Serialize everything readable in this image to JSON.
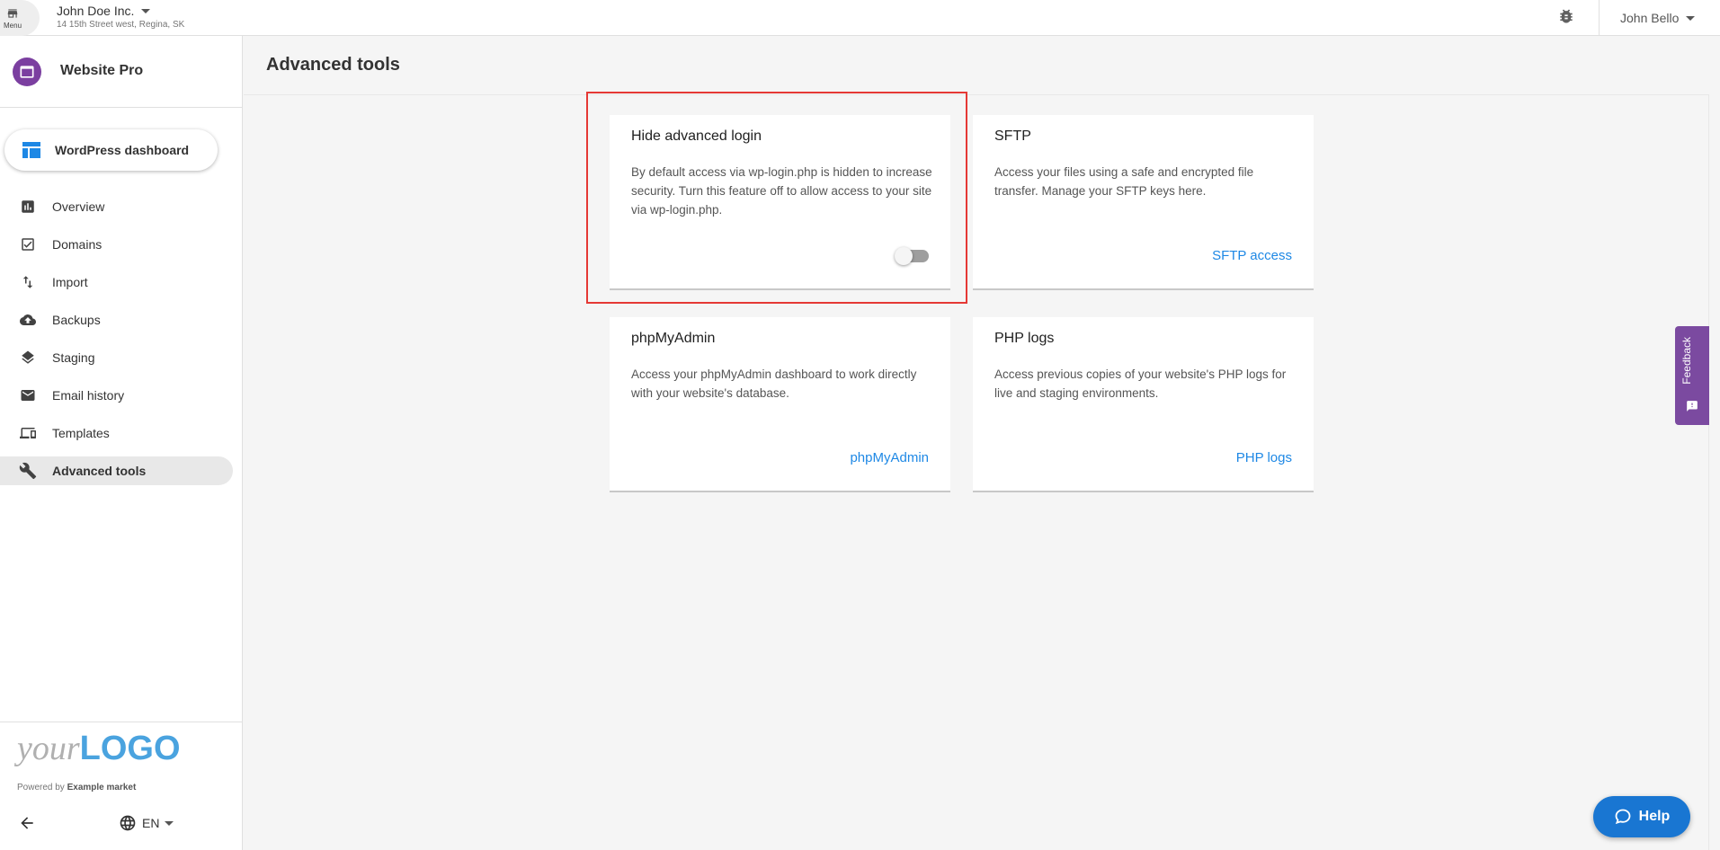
{
  "header": {
    "menu_label": "Menu",
    "business_name": "John Doe Inc.",
    "business_address": "14 15th Street west, Regina, SK",
    "user_name": "John Bello"
  },
  "sidebar": {
    "product_name": "Website Pro",
    "wp_button": "WordPress dashboard",
    "items": [
      {
        "label": "Overview",
        "icon": "bar-chart-icon"
      },
      {
        "label": "Domains",
        "icon": "checkbox-icon"
      },
      {
        "label": "Import",
        "icon": "swap-vertical-icon"
      },
      {
        "label": "Backups",
        "icon": "cloud-upload-icon"
      },
      {
        "label": "Staging",
        "icon": "layers-icon"
      },
      {
        "label": "Email history",
        "icon": "mail-icon"
      },
      {
        "label": "Templates",
        "icon": "devices-icon"
      },
      {
        "label": "Advanced tools",
        "icon": "wrench-icon"
      }
    ],
    "active_item": "Advanced tools",
    "logo_your": "your",
    "logo_big": "LOGO",
    "powered_prefix": "Powered by",
    "powered_brand": "Example market",
    "language": "EN"
  },
  "main": {
    "title": "Advanced tools",
    "cards": [
      {
        "title": "Hide advanced login",
        "description": "By default access via wp-login.php is hidden to increase security. Turn this feature off to allow access to your site via wp-login.php.",
        "toggle_on": false
      },
      {
        "title": "SFTP",
        "description": "Access your files using a safe and encrypted file transfer. Manage your SFTP keys here.",
        "link": "SFTP access"
      },
      {
        "title": "phpMyAdmin",
        "description": "Access your phpMyAdmin dashboard to work directly with your website's database.",
        "link": "phpMyAdmin"
      },
      {
        "title": "PHP logs",
        "description": "Access previous copies of your website's PHP logs for live and staging environments.",
        "link": "PHP logs"
      }
    ]
  },
  "feedback_label": "Feedback",
  "help_label": "Help",
  "colors": {
    "accent_link": "#1e88e5",
    "brand_purple": "#7b3fa0",
    "highlight": "#e53935",
    "help_button": "#1976d2"
  }
}
